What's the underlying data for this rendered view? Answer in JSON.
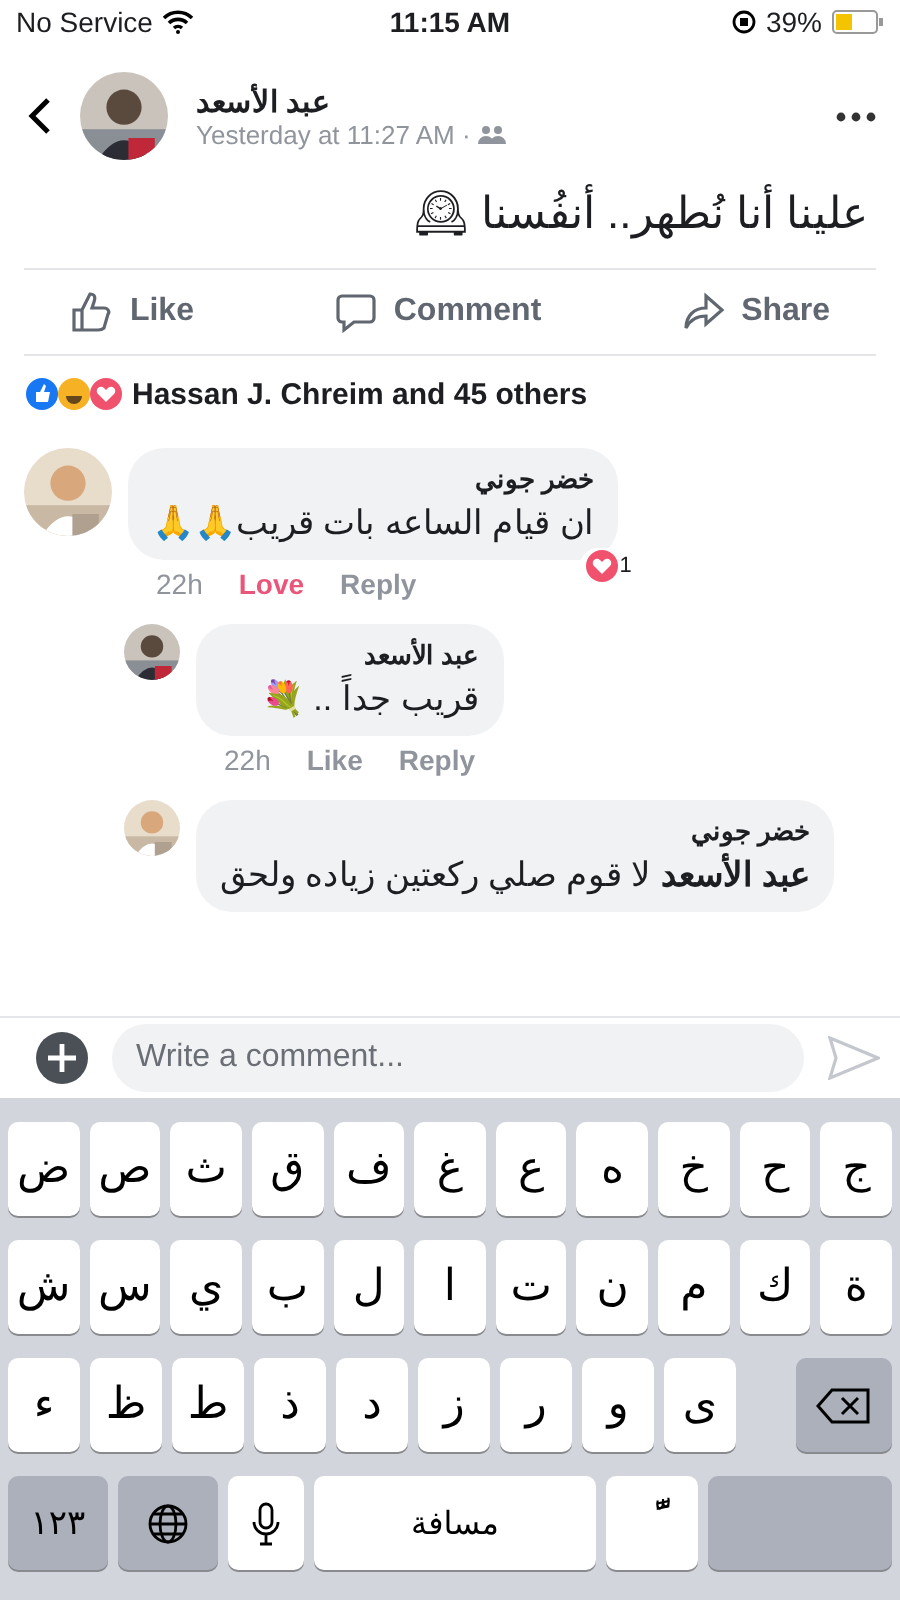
{
  "status_bar": {
    "carrier": "No Service",
    "time": "11:15 AM",
    "battery": "39%"
  },
  "post": {
    "author": "عبد الأسعد",
    "timestamp": "Yesterday at 11:27 AM ·",
    "text": "علينا أنا نُطهر.. أنفُسنا 🕰",
    "actions": {
      "like": "Like",
      "comment": "Comment",
      "share": "Share"
    },
    "reactions": {
      "summary": "Hassan J. Chreim and 45 others"
    }
  },
  "comments": [
    {
      "author": "خضر جوني",
      "text": "ان قيام الساعه بات قريب🙏🙏",
      "time": "22h",
      "reaction_link": {
        "kind": "love",
        "label": "Love"
      },
      "reply_link": "Reply",
      "reaction_count": "1",
      "children": [
        {
          "author": "عبد الأسعد",
          "text": "قريب جداً .. 💐",
          "time": "22h",
          "reaction_link": {
            "kind": "plain",
            "label": "Like"
          },
          "reply_link": "Reply"
        },
        {
          "author": "خضر جوني",
          "text": "**عبد الأسعد** لا قوم صلي ركعتين زياده ولحق",
          "cut": true
        }
      ]
    }
  ],
  "composer": {
    "placeholder": "Write a comment..."
  },
  "keyboard": {
    "rows": [
      {
        "keys": [
          "ج",
          "ح",
          "خ",
          "ه",
          "ع",
          "غ",
          "ف",
          "ق",
          "ث",
          "ص",
          "ض"
        ]
      },
      {
        "keys": [
          "ة",
          "ك",
          "م",
          "ن",
          "ت",
          "ا",
          "ل",
          "ب",
          "ي",
          "س",
          "ش"
        ]
      },
      {
        "keys": [
          "ى",
          "و",
          "ر",
          "ز",
          "د",
          "ذ",
          "ط",
          "ظ",
          "ء"
        ],
        "backspace": true
      }
    ],
    "bottom": [
      {
        "kind": "return"
      },
      {
        "kind": "diacritic",
        "label": "ًّ"
      },
      {
        "kind": "space",
        "label": "مسافة"
      },
      {
        "kind": "mic"
      },
      {
        "kind": "globe"
      },
      {
        "kind": "numbers",
        "label": "١٢٣"
      }
    ]
  }
}
